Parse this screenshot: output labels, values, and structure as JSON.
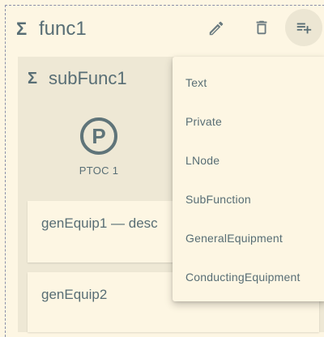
{
  "function": {
    "sigma": "Σ",
    "title": "func1"
  },
  "toolbar": {
    "edit_icon": "pencil-icon",
    "delete_icon": "trash-icon",
    "add_icon": "playlist-add-icon"
  },
  "subfunction": {
    "sigma": "Σ",
    "title": "subFunc1",
    "lnode": {
      "symbol": "P",
      "label": "PTOC 1"
    },
    "equipment": [
      {
        "label": "genEquip1 — desc"
      },
      {
        "label": "genEquip2"
      }
    ]
  },
  "add_menu": {
    "items": [
      {
        "label": "Text"
      },
      {
        "label": "Private"
      },
      {
        "label": "LNode"
      },
      {
        "label": "SubFunction"
      },
      {
        "label": "GeneralEquipment"
      },
      {
        "label": "ConductingEquipment"
      }
    ]
  },
  "colors": {
    "background": "#fdf6e3",
    "container": "#eee8d5",
    "text": "#586e75",
    "icon": "#6b7b80"
  }
}
